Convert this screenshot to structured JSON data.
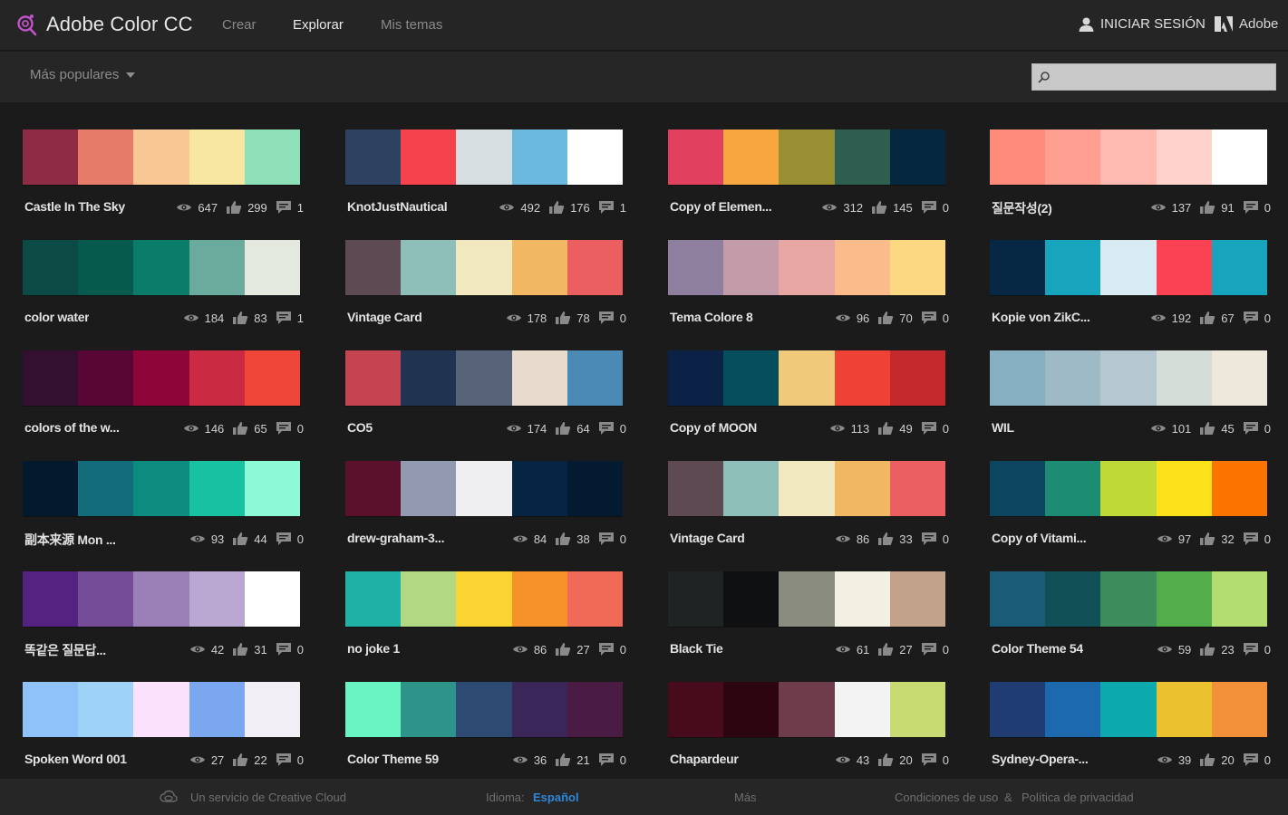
{
  "header": {
    "app_title": "Adobe Color CC",
    "nav": [
      {
        "label": "Crear",
        "active": false
      },
      {
        "label": "Explorar",
        "active": true
      },
      {
        "label": "Mis temas",
        "active": false
      }
    ],
    "signin_label": "INICIAR SESIÓN",
    "adobe_label": "Adobe",
    "icons": {
      "logo": "color-wheel-icon",
      "user": "user-icon",
      "adobe": "adobe-logo-icon"
    }
  },
  "toolbar": {
    "sort_label": "Más populares",
    "search_value": "",
    "search_placeholder": ""
  },
  "themes": [
    {
      "name": "Castle In The Sky",
      "views": "647",
      "likes": "299",
      "comments": "1",
      "colors": [
        "#8e2c45",
        "#e67b68",
        "#f8c793",
        "#f7e7a1",
        "#8ee0b8"
      ]
    },
    {
      "name": "KnotJustNautical",
      "views": "492",
      "likes": "176",
      "comments": "1",
      "colors": [
        "#2d4160",
        "#f5424c",
        "#d7dee0",
        "#6bb9de",
        "#ffffff"
      ]
    },
    {
      "name": "Copy of Elemen...",
      "views": "312",
      "likes": "145",
      "comments": "0",
      "colors": [
        "#e1405e",
        "#f8a640",
        "#978f32",
        "#2d5e4f",
        "#05283e"
      ]
    },
    {
      "name": "질문작성(2)",
      "views": "137",
      "likes": "91",
      "comments": "0",
      "colors": [
        "#ff8b7a",
        "#ff9f91",
        "#ffb9b0",
        "#ffd2cc",
        "#ffffff"
      ]
    },
    {
      "name": "color water",
      "views": "184",
      "likes": "83",
      "comments": "1",
      "colors": [
        "#0c4a46",
        "#06594d",
        "#0b7b6a",
        "#6aab9d",
        "#e4e9e0"
      ]
    },
    {
      "name": "Vintage Card",
      "views": "178",
      "likes": "78",
      "comments": "0",
      "colors": [
        "#5d4a52",
        "#8dbfb8",
        "#f2e8c0",
        "#f1b763",
        "#ec5f60"
      ]
    },
    {
      "name": "Tema Colore 8",
      "views": "96",
      "likes": "70",
      "comments": "0",
      "colors": [
        "#8f7f9e",
        "#c49ba8",
        "#e8a6a3",
        "#fcbb8a",
        "#fcd882"
      ]
    },
    {
      "name": "Kopie von ZikC...",
      "views": "192",
      "likes": "67",
      "comments": "0",
      "colors": [
        "#062845",
        "#17a4bd",
        "#d8ebf3",
        "#fb4253",
        "#17a4bd"
      ]
    },
    {
      "name": "colors of the w...",
      "views": "146",
      "likes": "65",
      "comments": "0",
      "colors": [
        "#330f30",
        "#580633",
        "#8e0638",
        "#cb2a43",
        "#ef4639"
      ]
    },
    {
      "name": "CO5",
      "views": "174",
      "likes": "64",
      "comments": "0",
      "colors": [
        "#c64451",
        "#203451",
        "#576378",
        "#e6dbcd",
        "#4a8ab4"
      ]
    },
    {
      "name": "Copy of MOON",
      "views": "113",
      "likes": "49",
      "comments": "0",
      "colors": [
        "#0b2146",
        "#064e5d",
        "#f0c97a",
        "#ee4237",
        "#c42a2d"
      ]
    },
    {
      "name": "WIL",
      "views": "101",
      "likes": "45",
      "comments": "0",
      "colors": [
        "#86afc2",
        "#9dbac6",
        "#b5c8cf",
        "#d5ddd8",
        "#ede7dc"
      ]
    },
    {
      "name": "副本来源 Mon ...",
      "views": "93",
      "likes": "44",
      "comments": "0",
      "colors": [
        "#031a2e",
        "#136c79",
        "#0c8c7f",
        "#18c2a0",
        "#8ef9d7"
      ]
    },
    {
      "name": "drew-graham-3...",
      "views": "84",
      "likes": "38",
      "comments": "0",
      "colors": [
        "#5b102c",
        "#9399ae",
        "#efeff2",
        "#062544",
        "#041a31"
      ]
    },
    {
      "name": "Vintage Card",
      "views": "86",
      "likes": "33",
      "comments": "0",
      "colors": [
        "#5d4a52",
        "#8dbfb8",
        "#f2e8c0",
        "#f1b763",
        "#ec5f60"
      ]
    },
    {
      "name": "Copy of Vitami...",
      "views": "97",
      "likes": "32",
      "comments": "0",
      "colors": [
        "#0b4560",
        "#1c8c73",
        "#bfd937",
        "#fde11a",
        "#fb7400"
      ]
    },
    {
      "name": "똑같은 질문답...",
      "views": "42",
      "likes": "31",
      "comments": "0",
      "colors": [
        "#542382",
        "#744c98",
        "#9a80b6",
        "#bba8d2",
        "#ffffff"
      ]
    },
    {
      "name": "no joke 1",
      "views": "86",
      "likes": "27",
      "comments": "0",
      "colors": [
        "#1fb1a5",
        "#b3d884",
        "#fad431",
        "#f7922a",
        "#f16a57"
      ]
    },
    {
      "name": "Black Tie",
      "views": "61",
      "likes": "27",
      "comments": "0",
      "colors": [
        "#1f2324",
        "#0f1011",
        "#8a8c80",
        "#f2f0e2",
        "#c2a38a"
      ]
    },
    {
      "name": "Color Theme 54",
      "views": "59",
      "likes": "23",
      "comments": "0",
      "colors": [
        "#1a5c78",
        "#125058",
        "#3d8d5c",
        "#52ae4a",
        "#b3dd6e"
      ]
    },
    {
      "name": "Spoken Word 001",
      "views": "27",
      "likes": "22",
      "comments": "0",
      "colors": [
        "#8ec2f8",
        "#9ed3f7",
        "#fbe1fb",
        "#7aa7f0",
        "#f1eef6"
      ]
    },
    {
      "name": "Color Theme 59",
      "views": "36",
      "likes": "21",
      "comments": "0",
      "colors": [
        "#6af3c3",
        "#2e9388",
        "#2d4a73",
        "#3a2658",
        "#4a1c43"
      ]
    },
    {
      "name": "Chapardeur",
      "views": "43",
      "likes": "20",
      "comments": "0",
      "colors": [
        "#470b1b",
        "#2c0511",
        "#6f3c4b",
        "#f3f3f3",
        "#c8db73"
      ]
    },
    {
      "name": "Sydney-Opera-...",
      "views": "39",
      "likes": "20",
      "comments": "0",
      "colors": [
        "#1f3d73",
        "#1c6aad",
        "#0caaae",
        "#ecc12f",
        "#f2913a"
      ]
    }
  ],
  "footer": {
    "service_label": "Un servicio de Creative Cloud",
    "language_label": "Idioma:",
    "language_value": "Español",
    "more_label": "Más",
    "terms_label": "Condiciones de uso",
    "amp": "&",
    "privacy_label": "Política de privacidad"
  },
  "colors": {
    "background": "#1b1b1b",
    "bar": "#262626",
    "link": "#2f86d8",
    "logo_accent": "#c252c9"
  }
}
